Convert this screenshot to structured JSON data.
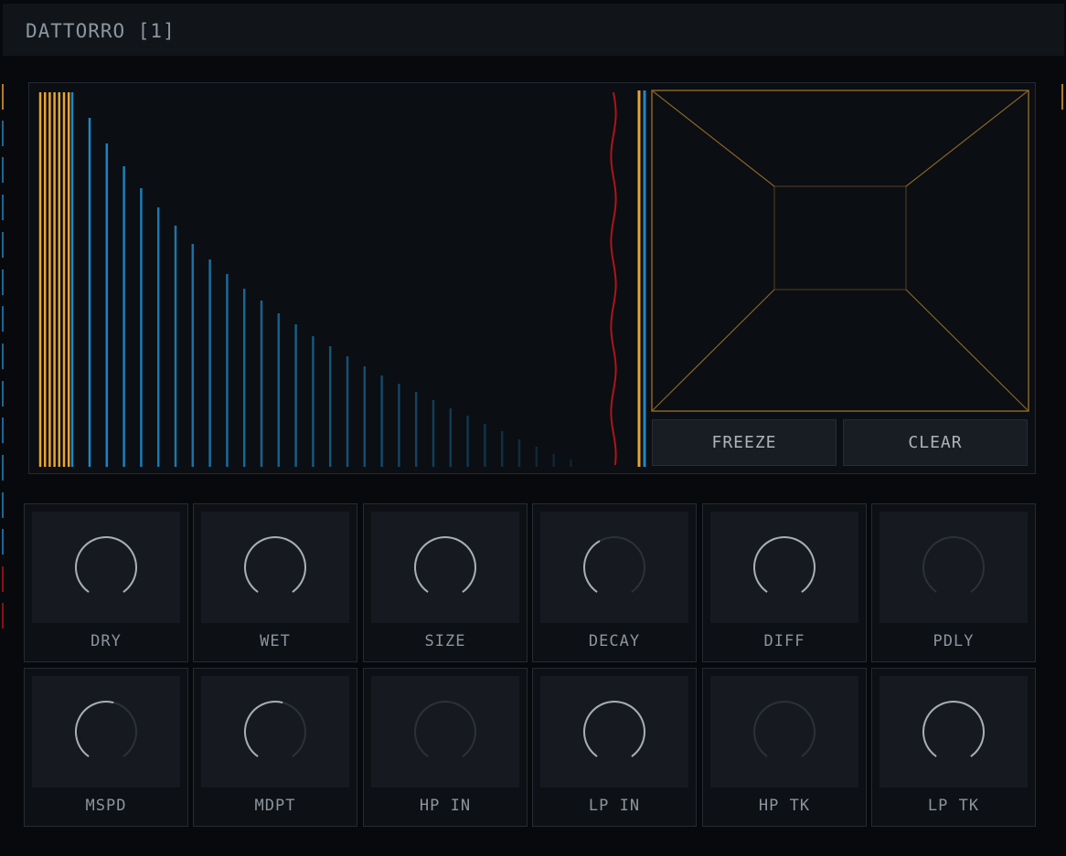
{
  "window": {
    "title": "DATTORRO [1]"
  },
  "buttons": {
    "freeze": "FREEZE",
    "clear": "CLEAR"
  },
  "colors": {
    "accent_orange": "#e8a430",
    "accent_blue": "#1e88c8",
    "waveform_red": "#b0141a",
    "room_lines": "#8a6428",
    "knob_arc": "#a8aeb5",
    "knob_arc_dim": "#2c3138"
  },
  "knobs": [
    {
      "id": "dry",
      "label": "DRY",
      "level": 1.0,
      "active": true
    },
    {
      "id": "wet",
      "label": "WET",
      "level": 1.0,
      "active": true
    },
    {
      "id": "size",
      "label": "SIZE",
      "level": 1.0,
      "active": true
    },
    {
      "id": "decay",
      "label": "DECAY",
      "level": 0.4,
      "active": true
    },
    {
      "id": "diff",
      "label": "DIFF",
      "level": 1.0,
      "active": true
    },
    {
      "id": "pdly",
      "label": "PDLY",
      "level": 0.0,
      "active": false
    },
    {
      "id": "mspd",
      "label": "MSPD",
      "level": 0.55,
      "active": true
    },
    {
      "id": "mdpt",
      "label": "MDPT",
      "level": 0.55,
      "active": true
    },
    {
      "id": "hpin",
      "label": "HP IN",
      "level": 0.0,
      "active": false
    },
    {
      "id": "lpin",
      "label": "LP IN",
      "level": 1.0,
      "active": true
    },
    {
      "id": "hptk",
      "label": "HP TK",
      "level": 0.0,
      "active": false
    },
    {
      "id": "lptk",
      "label": "LP TK",
      "level": 1.0,
      "active": true
    }
  ]
}
